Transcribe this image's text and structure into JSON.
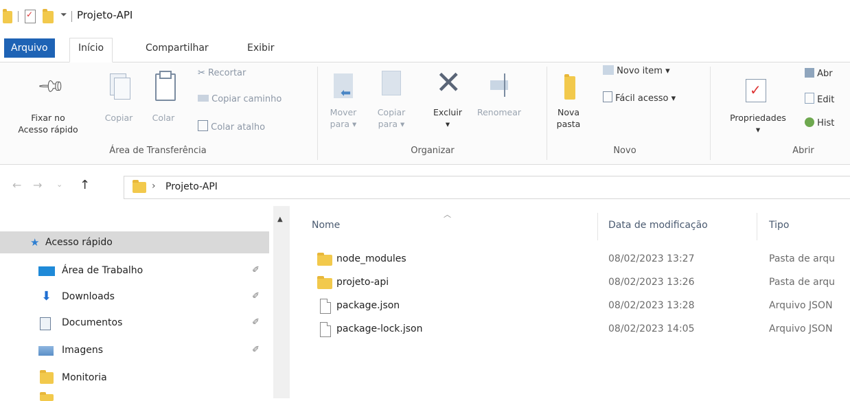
{
  "window": {
    "title": "Projeto-API"
  },
  "tabs": {
    "file": "Arquivo",
    "home": "Início",
    "share": "Compartilhar",
    "view": "Exibir"
  },
  "ribbon": {
    "clipboard": {
      "pin_line1": "Fixar no",
      "pin_line2": "Acesso rápido",
      "copy": "Copiar",
      "paste": "Colar",
      "cut": "Recortar",
      "copy_path": "Copiar caminho",
      "paste_shortcut": "Colar atalho",
      "group": "Área de Transferência"
    },
    "organize": {
      "move_line1": "Mover",
      "move_line2": "para ▾",
      "copyto_line1": "Copiar",
      "copyto_line2": "para ▾",
      "delete": "Excluir",
      "delete_arrow": "▾",
      "rename": "Renomear",
      "group": "Organizar"
    },
    "new": {
      "new_folder_line1": "Nova",
      "new_folder_line2": "pasta",
      "new_item": "Novo item ▾",
      "easy_access": "Fácil acesso ▾",
      "group": "Novo"
    },
    "open": {
      "properties": "Propriedades",
      "properties_arrow": "▾",
      "open": "Abr",
      "edit": "Edit",
      "history": "Hist",
      "group": "Abrir"
    }
  },
  "address": {
    "separator": "›",
    "path": "Projeto-API"
  },
  "nav": {
    "items": [
      {
        "label": "Acesso rápido",
        "icon": "star-icon",
        "selected": true
      },
      {
        "label": "Área de Trabalho",
        "icon": "desktop-icon",
        "pinned": true
      },
      {
        "label": "Downloads",
        "icon": "download-icon",
        "pinned": true
      },
      {
        "label": "Documentos",
        "icon": "document-icon",
        "pinned": true
      },
      {
        "label": "Imagens",
        "icon": "pictures-icon",
        "pinned": true
      },
      {
        "label": "Monitoria",
        "icon": "folder-icon"
      }
    ],
    "pin_glyph": "✐"
  },
  "list": {
    "columns": {
      "name": "Nome",
      "date": "Data de modificação",
      "type": "Tipo"
    },
    "rows": [
      {
        "name": "node_modules",
        "date": "08/02/2023 13:27",
        "type": "Pasta de arqu",
        "icon": "folder-icon"
      },
      {
        "name": "projeto-api",
        "date": "08/02/2023 13:26",
        "type": "Pasta de arqu",
        "icon": "folder-icon"
      },
      {
        "name": "package.json",
        "date": "08/02/2023 13:28",
        "type": "Arquivo JSON",
        "icon": "file-icon"
      },
      {
        "name": "package-lock.json",
        "date": "08/02/2023 14:05",
        "type": "Arquivo JSON",
        "icon": "file-icon"
      }
    ]
  },
  "colors": {
    "file_tab": "#1e63b5",
    "folder": "#f2c94c",
    "selection": "#d9d9d9"
  }
}
